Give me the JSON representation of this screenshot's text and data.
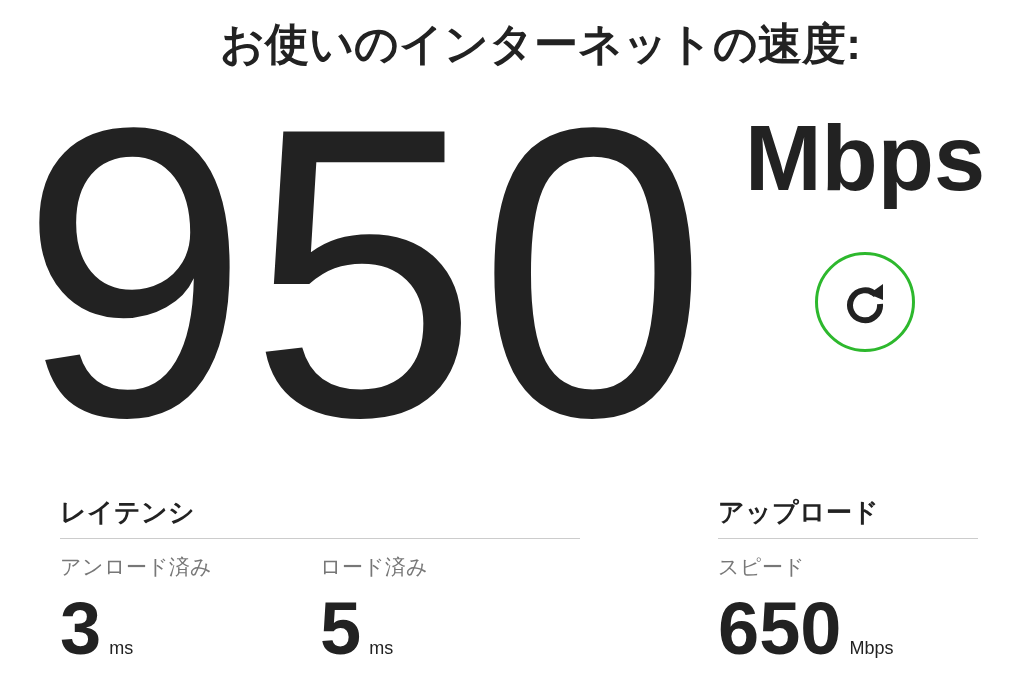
{
  "title": "お使いのインターネットの速度:",
  "speed": {
    "value": "950",
    "unit": "Mbps"
  },
  "sections": [
    {
      "heading": "レイテンシ",
      "metrics": [
        {
          "label": "アンロード済み",
          "value": "3",
          "unit": "ms"
        },
        {
          "label": "ロード済み",
          "value": "5",
          "unit": "ms"
        }
      ]
    },
    {
      "heading": "アップロード",
      "metrics": [
        {
          "label": "スピード",
          "value": "650",
          "unit": "Mbps"
        }
      ]
    }
  ]
}
